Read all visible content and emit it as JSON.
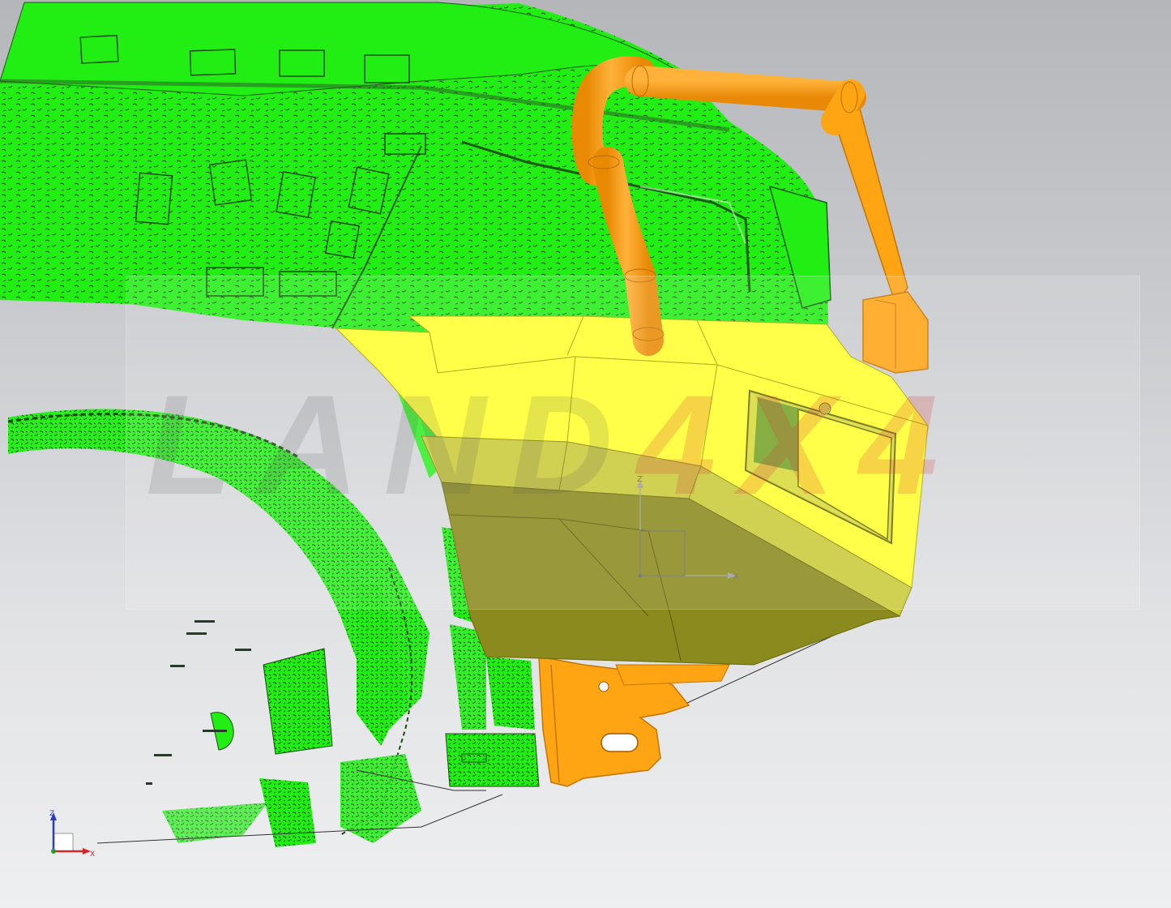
{
  "viewport": {
    "watermark": {
      "primary": "LAND",
      "accent": "4X4",
      "text": "LAND4X4"
    },
    "colors": {
      "scan_mesh": "#21ef14",
      "scan_edge": "#1a5a12",
      "bumper_top": "#ffff2e",
      "bumper_mid": "#c9c93a",
      "bumper_low": "#8a8a1e",
      "tube_rails": "#ffa514",
      "background_top": "#b4b6ba",
      "background_bottom": "#eeeff0"
    },
    "wcs_axes": {
      "x_label": "X",
      "z_label": "Z"
    },
    "view_triad": {
      "x_label": "X",
      "z_label": "Z"
    }
  }
}
